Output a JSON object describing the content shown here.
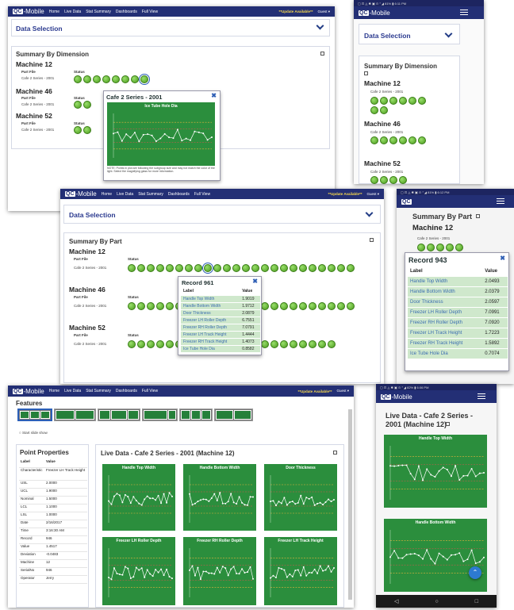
{
  "app": {
    "logo_qc": "QC",
    "logo_mobile": "-Mobile",
    "nav": [
      "Home",
      "Live Data",
      "Stat Summary",
      "Dashboards",
      "Full View"
    ],
    "update": "**Update Available**",
    "guest": "Guest ▾"
  },
  "colors": {
    "navbar": "#232f75",
    "chart_green": "#2b8e3d",
    "dot_green": "#5cb52a",
    "row_green": "#cfe8cc",
    "link_blue": "#3a6db0"
  },
  "icons": {
    "collapse": "chevron-down-icon",
    "expand": "external-link-icon",
    "close": "close-icon",
    "menu": "hamburger-icon",
    "scroll_top": "chevron-up-icon"
  },
  "s1": {
    "data_selection": "Data Selection",
    "summary_title": "Summary By Dimension",
    "col_part": "Part File",
    "col_status": "Status",
    "machines": [
      {
        "name": "Machine 12",
        "part": "Cafe 2 Series - 2001"
      },
      {
        "name": "Machine 46",
        "part": "Cafe 2 Series - 2001"
      },
      {
        "name": "Machine 52",
        "part": "Cafe 2 Series - 2001"
      }
    ],
    "popup": {
      "title": "Cafe 2 Series - 2001",
      "chart_title": "Ice Tube Hole Dia",
      "note": "NOTE: Points in plot are following the subgroup size and may not match the color of the light. Select the magnifying glass for more information."
    }
  },
  "s2": {
    "status": "▢ ⊡ ◬   ✱ ▣ ⊙ ⁷ ◢ 81% ▮ 6:11 PM",
    "data_selection": "Data Selection",
    "summary_title": "Summary By Dimension",
    "machines": [
      {
        "name": "Machine 12",
        "part": "Cafe 2 Series - 2001"
      },
      {
        "name": "Machine 46",
        "part": "Cafe 2 Series - 2001"
      },
      {
        "name": "Machine 52",
        "part": "Cafe 2 Series - 2001"
      }
    ]
  },
  "s3": {
    "data_selection": "Data Selection",
    "summary_title": "Summary By Part",
    "col_part": "Part File",
    "col_status": "Status",
    "machines": [
      {
        "name": "Machine 12",
        "part": "Cafe 2 Series - 2001"
      },
      {
        "name": "Machine 46",
        "part": "Cafe 2 Series - 2001"
      },
      {
        "name": "Machine 52",
        "part": "Cafe 2 Series - 2001"
      }
    ],
    "record": {
      "title": "Record 961",
      "col_label": "Label",
      "col_value": "Value",
      "rows": [
        [
          "Handle Top Width",
          "1.9019"
        ],
        [
          "Handle Bottom Width",
          "1.9712"
        ],
        [
          "Door Thickness",
          "2.0879"
        ],
        [
          "Freezer LH Roller Depth",
          "6.7551"
        ],
        [
          "Freezer RH Roller Depth",
          "7.0791"
        ],
        [
          "Freezer LH Track Height",
          "1.4444"
        ],
        [
          "Freezer RH Track Height",
          "1.4073"
        ],
        [
          "Ice Tube Hole Dia",
          "0.8582"
        ]
      ]
    }
  },
  "s4": {
    "status": "▢ ⊡ ◬   ✱ ▣ ⊙ ⁷ ◢ 81% ▮ 6:12 PM",
    "summary_title": "Summary By Part",
    "machine": "Machine 12",
    "part": "Cafe 2 Series - 2001",
    "record": {
      "title": "Record 943",
      "col_label": "Label",
      "col_value": "Value",
      "rows": [
        [
          "Handle Top Width",
          "2.0493"
        ],
        [
          "Handle Bottom Width",
          "2.0379"
        ],
        [
          "Door Thickness",
          "2.0597"
        ],
        [
          "Freezer LH Roller Depth",
          "7.0991"
        ],
        [
          "Freezer RH Roller Depth",
          "7.0920"
        ],
        [
          "Freezer LH Track Height",
          "1.7223"
        ],
        [
          "Freezer RH Track Height",
          "1.5892"
        ],
        [
          "Ice Tube Hole Dia",
          "0.7074"
        ]
      ]
    }
  },
  "s5": {
    "features": "Features",
    "slideshow": "Start slide show",
    "pp_title": "Point Properties",
    "pp_head": [
      "Label",
      "Value"
    ],
    "pp_rows": [
      [
        "Characteristic",
        "Freezer LH Track Height"
      ],
      [
        "USL",
        "2.0000"
      ],
      [
        "UCL",
        "1.9000"
      ],
      [
        "Nominal",
        "1.5000"
      ],
      [
        "LCL",
        "1.1000"
      ],
      [
        "LSL",
        "1.0000"
      ],
      [
        "Date",
        "2/16/2017"
      ],
      [
        "Time",
        "3:16:30 AM"
      ],
      [
        "Record",
        "946"
      ],
      [
        "Value",
        "1.4517"
      ],
      [
        "Deviation",
        "-0.0483"
      ],
      [
        "Machine",
        "12"
      ],
      [
        "SerialNo",
        "946"
      ],
      [
        "Operator",
        "Jerry"
      ]
    ],
    "live_title": "Live Data - Cafe 2 Series - 2001 (Machine 12)",
    "charts": [
      "Handle Top Width",
      "Handle Bottom Width",
      "Door Thickness",
      "Freezer LH Roller Depth",
      "Freezer RH Roller Depth",
      "Freezer LH Track Height"
    ]
  },
  "s6": {
    "status": "▢ ⊡ ◬   ✱ ▣ ⊙ ⁷ ◢ 82% ▮ 6:06 PM",
    "title": "Live Data - Cafe 2 Series - 2001 (Machine 12)",
    "charts": [
      "Handle Top Width",
      "Handle Bottom Width"
    ],
    "nav": [
      "◁",
      "○",
      "□"
    ]
  }
}
